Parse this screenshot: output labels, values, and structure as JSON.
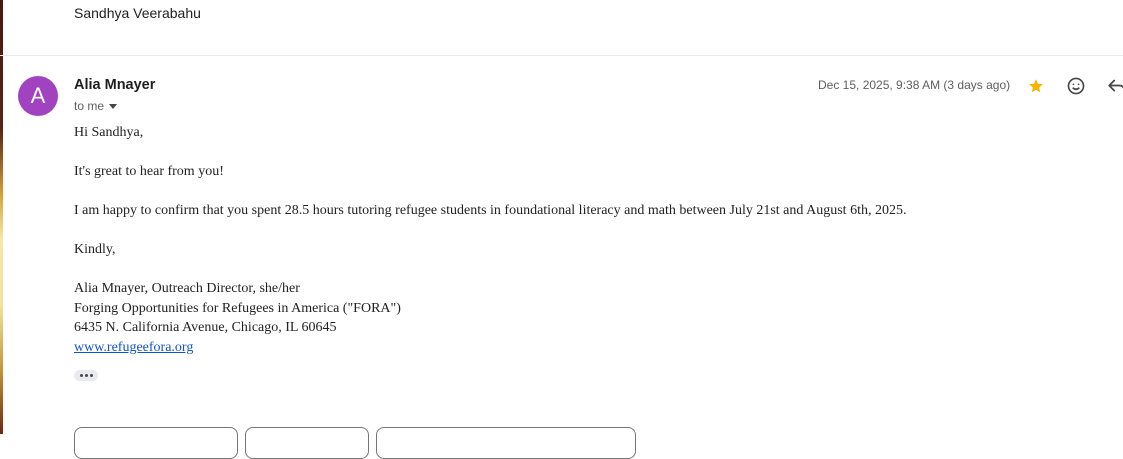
{
  "previous_message": {
    "sender": "Sandhya Veerabahu"
  },
  "message": {
    "avatar_letter": "A",
    "avatar_color": "#a142c0",
    "sender_name": "Alia Mnayer",
    "recipient": "to me",
    "date": "Dec 15, 2025, 9:38 AM (3 days ago)",
    "starred": true,
    "star_color": "#f4b400",
    "icons": [
      "star-icon",
      "emoji-reaction-icon",
      "reply-icon"
    ],
    "greeting": "Hi Sandhya,",
    "line1": "It's great to hear from you!",
    "line2": "I am happy to confirm that you spent 28.5 hours tutoring refugee students in foundational literacy and math between July 21st and August 6th, 2025.",
    "closing": "Kindly,",
    "signature": {
      "name_title": "Alia Mnayer, Outreach Director, she/her",
      "org": "Forging Opportunities for Refugees in America (\"FORA\")",
      "address": "6435 N. California Avenue, Chicago, IL 60645",
      "website": "www.refugeefora.org"
    }
  },
  "link_color": "#1155cc"
}
